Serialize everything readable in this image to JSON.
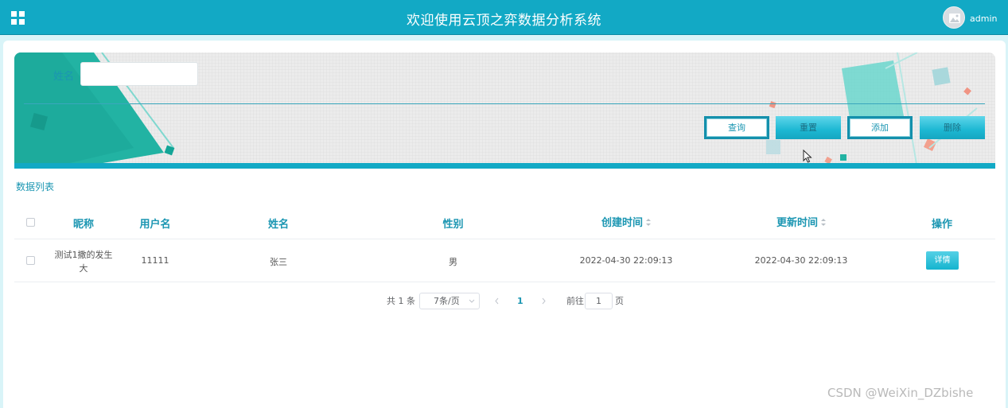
{
  "header": {
    "title": "欢迎使用云顶之弈数据分析系统",
    "user_name": "admin"
  },
  "search": {
    "name_label": "姓名",
    "name_value": "",
    "buttons": {
      "query": "查询",
      "reset": "重置",
      "add": "添加",
      "delete": "删除"
    }
  },
  "list": {
    "title": "数据列表",
    "columns": [
      "昵称",
      "用户名",
      "姓名",
      "性别",
      "创建时间",
      "更新时间",
      "操作"
    ],
    "rows": [
      {
        "nickname_line1": "测试1撒的发生",
        "nickname_line2": "大",
        "username": "11111",
        "name": "张三",
        "gender": "男",
        "created": "2022-04-30 22:09:13",
        "updated": "2022-04-30 22:09:13",
        "action": "详情"
      }
    ]
  },
  "pagination": {
    "total": "共 1 条",
    "page_size": "7条/页",
    "current_page": "1",
    "goto_label": "前往",
    "goto_value": "1",
    "page_unit": "页"
  },
  "watermark": "CSDN @WeiXin_DZbishe",
  "colors": {
    "primary": "#12a9c5",
    "accent_teal": "#22b3a3"
  }
}
